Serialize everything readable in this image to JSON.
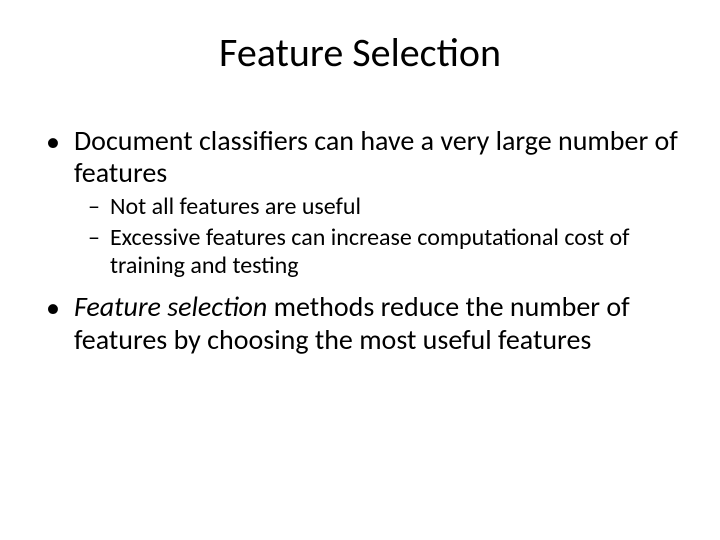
{
  "slide": {
    "title": "Feature Selection",
    "bullets": [
      {
        "level": 1,
        "text": "Document classifiers can have a very large number of features"
      },
      {
        "level": 2,
        "text": "Not all features are useful"
      },
      {
        "level": 2,
        "text": "Excessive features can increase computational cost of training and testing"
      },
      {
        "level": 1,
        "italic_lead": "Feature selection",
        "text_rest": " methods reduce the number of features by choosing the most useful features"
      }
    ]
  }
}
